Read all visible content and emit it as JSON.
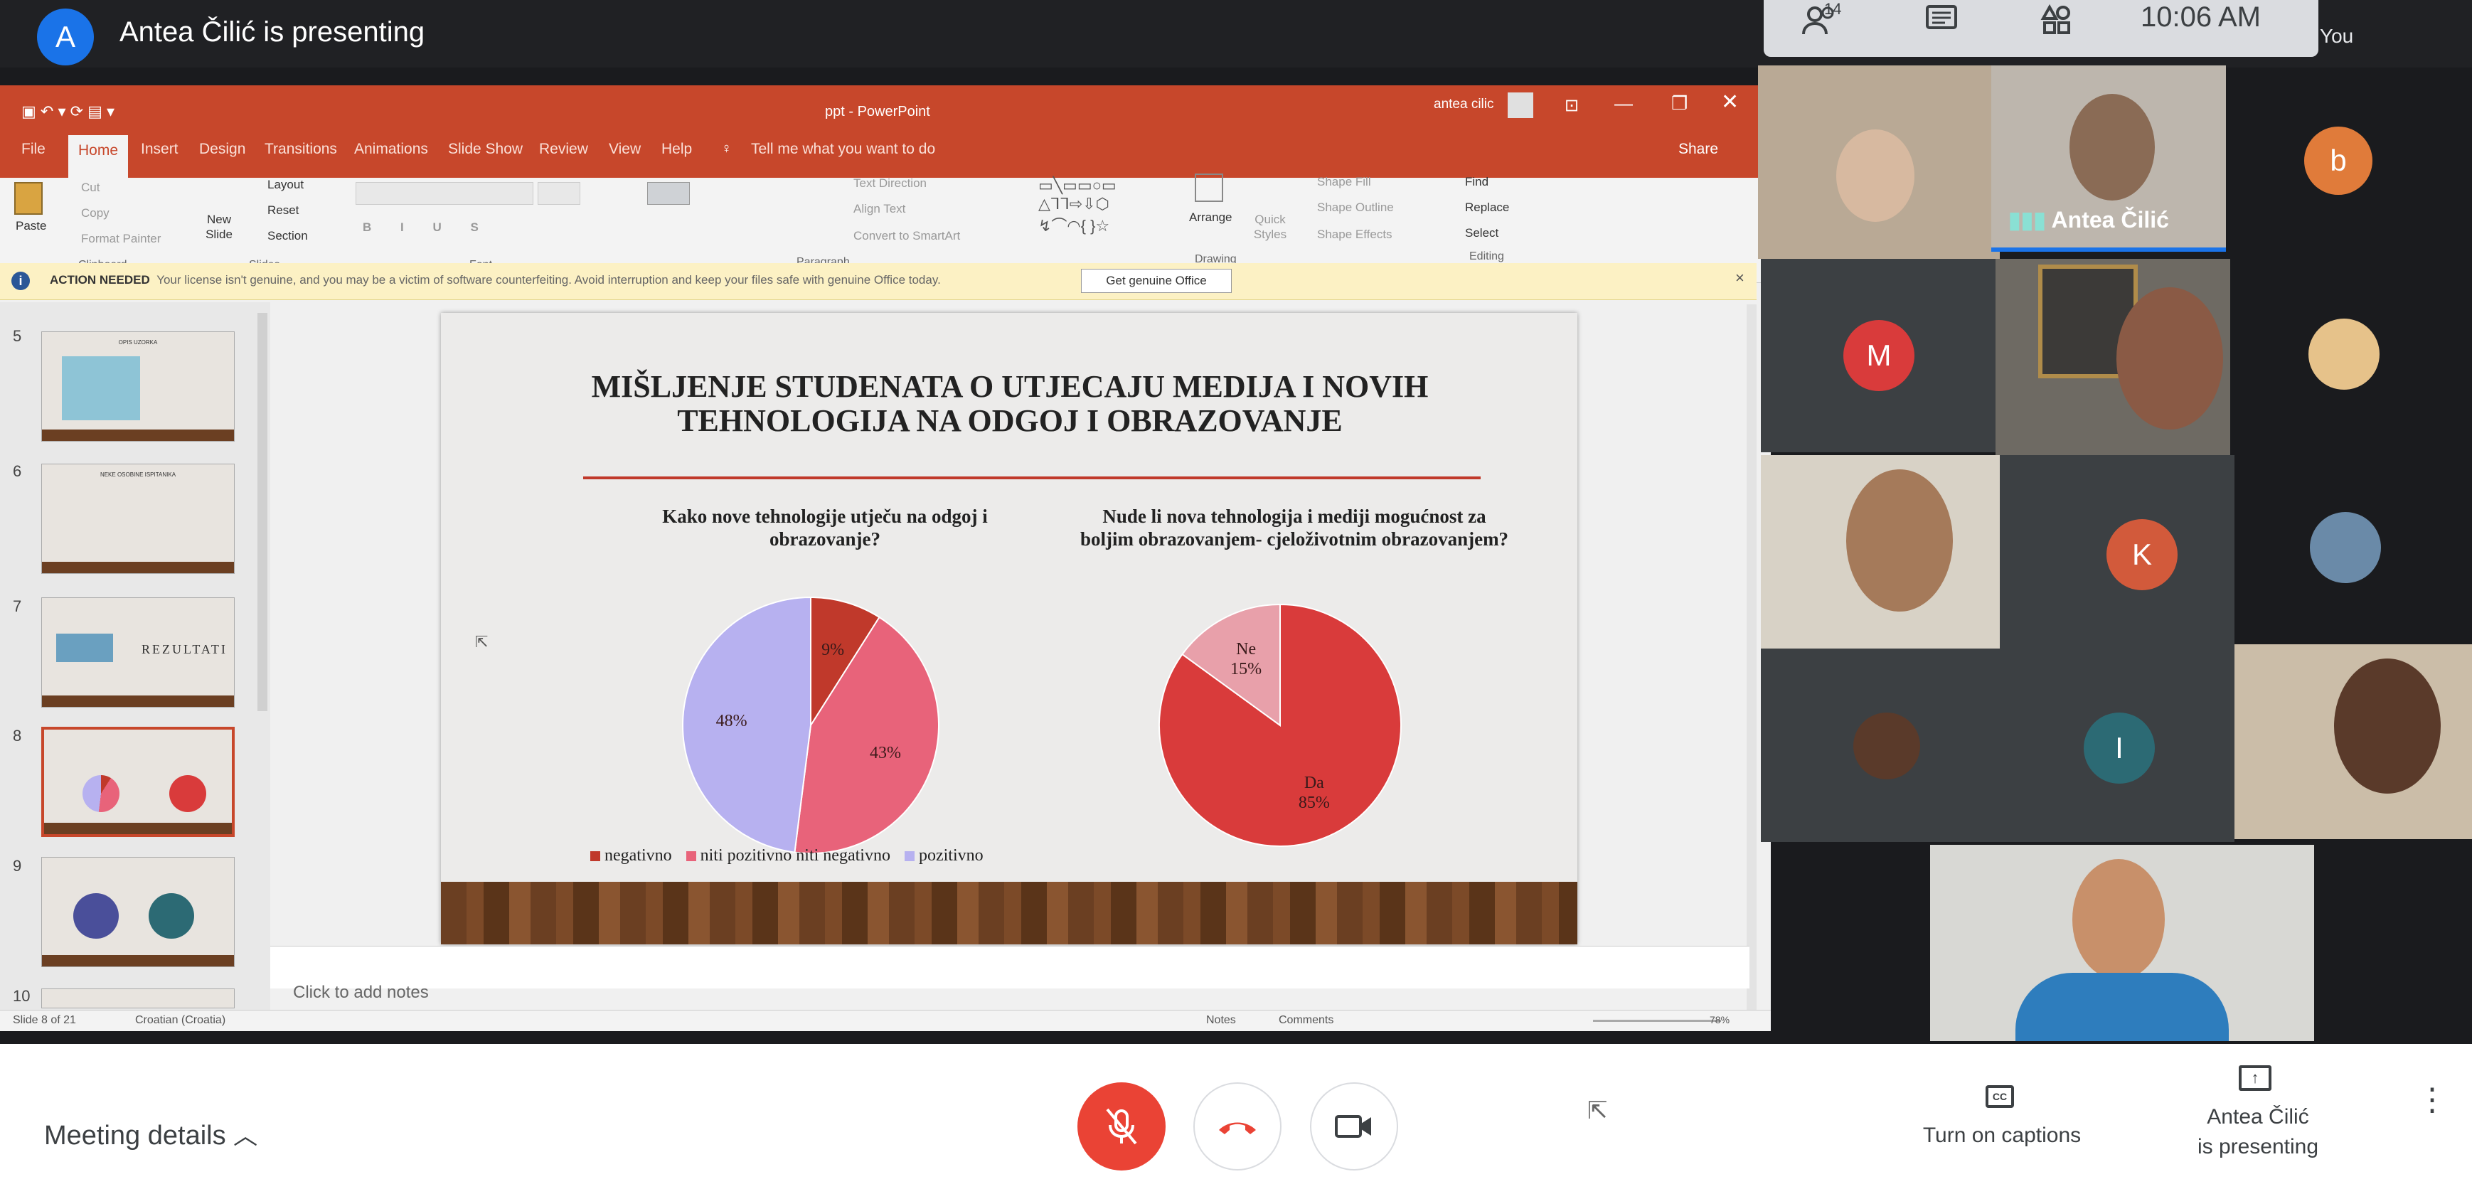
{
  "meet": {
    "presenter_initial": "A",
    "presenter_title": "Antea Čilić is presenting",
    "participant_count": "14",
    "clock": "10:06 AM",
    "you_label": "You",
    "meeting_details": "Meeting details",
    "captions_label": "Turn on captions",
    "present_label_line1": "Antea Čilić",
    "present_label_line2": "is presenting"
  },
  "colors": {
    "meet_dark": "#202124",
    "ppt_orange": "#c7472b",
    "end_red": "#ea4335",
    "slice_red": "#c0392b",
    "slice_pink": "#e8637a",
    "slice_lavender": "#b7b1f0"
  },
  "ppt": {
    "window_title": "ppt - PowerPoint",
    "user": "antea cilic",
    "share": "Share",
    "tabs": [
      "File",
      "Home",
      "Insert",
      "Design",
      "Transitions",
      "Animations",
      "Slide Show",
      "Review",
      "View",
      "Help"
    ],
    "tell_me": "Tell me what you want to do",
    "clipboard": {
      "paste": "Paste",
      "cut": "Cut",
      "copy": "Copy",
      "format_painter": "Format Painter",
      "label": "Clipboard"
    },
    "slides": {
      "new_slide": "New Slide",
      "layout": "Layout",
      "reset": "Reset",
      "section": "Section",
      "label": "Slides"
    },
    "font": {
      "label": "Font"
    },
    "paragraph": {
      "text_direction": "Text Direction",
      "align_text": "Align Text",
      "convert": "Convert to SmartArt",
      "label": "Paragraph"
    },
    "drawing": {
      "arrange": "Arrange",
      "quick_styles": "Quick Styles",
      "shape_fill": "Shape Fill",
      "shape_outline": "Shape Outline",
      "shape_effects": "Shape Effects",
      "label": "Drawing"
    },
    "editing": {
      "find": "Find",
      "replace": "Replace",
      "select": "Select",
      "label": "Editing"
    },
    "warning": {
      "label": "ACTION NEEDED",
      "text": "Your license isn't genuine, and you may be a victim of software counterfeiting. Avoid interruption and keep your files safe with genuine Office today.",
      "button": "Get genuine Office"
    },
    "thumbnails": [
      {
        "num": "5",
        "title": "OPIS UZORKA"
      },
      {
        "num": "6",
        "title": "NEKE OSOBINE ISPITANIKA"
      },
      {
        "num": "7",
        "title": "REZULTATI"
      },
      {
        "num": "8",
        "title": ""
      },
      {
        "num": "9",
        "title": ""
      },
      {
        "num": "10",
        "title": ""
      }
    ],
    "notes_placeholder": "Click to add notes",
    "status": {
      "slide": "Slide 8 of 21",
      "language": "Croatian (Croatia)",
      "notes": "Notes",
      "comments": "Comments",
      "zoom": "78%"
    }
  },
  "slide": {
    "title": "MIŠLJENJE STUDENATA O UTJECAJU MEDIJA I NOVIH TEHNOLOGIJA NA ODGOJ I OBRAZOVANJE",
    "q1": "Kako nove tehnologije utječu na odgoj i obrazovanje?",
    "q2": "Nude li nova tehnologija i mediji mogućnost za boljim obrazovanjem- cjeloživotnim obrazovanjem?"
  },
  "chart_data": [
    {
      "type": "pie",
      "categories": [
        "negativno",
        "niti pozitivno niti negativno",
        "pozitivno"
      ],
      "values": [
        9,
        43,
        48
      ],
      "labels": [
        "9%",
        "43%",
        "48%"
      ],
      "colors": [
        "#c0392b",
        "#e8637a",
        "#b7b1f0"
      ],
      "legend": "bottom"
    },
    {
      "type": "pie",
      "categories": [
        "Da",
        "Ne"
      ],
      "values": [
        85,
        15
      ],
      "labels": [
        "Da\n85%",
        "Ne\n15%"
      ],
      "colors": [
        "#d93b3b",
        "#e8a0aa"
      ]
    }
  ],
  "participants": [
    {
      "initial": "b",
      "color": "#e07b3a"
    },
    {
      "initial": "M",
      "color": "#d93b3b"
    },
    {
      "initial": "K",
      "color": "#d25a3b"
    },
    {
      "initial": "I",
      "color": "#2c6a74"
    }
  ],
  "active_speaker": "Antea Čilić"
}
